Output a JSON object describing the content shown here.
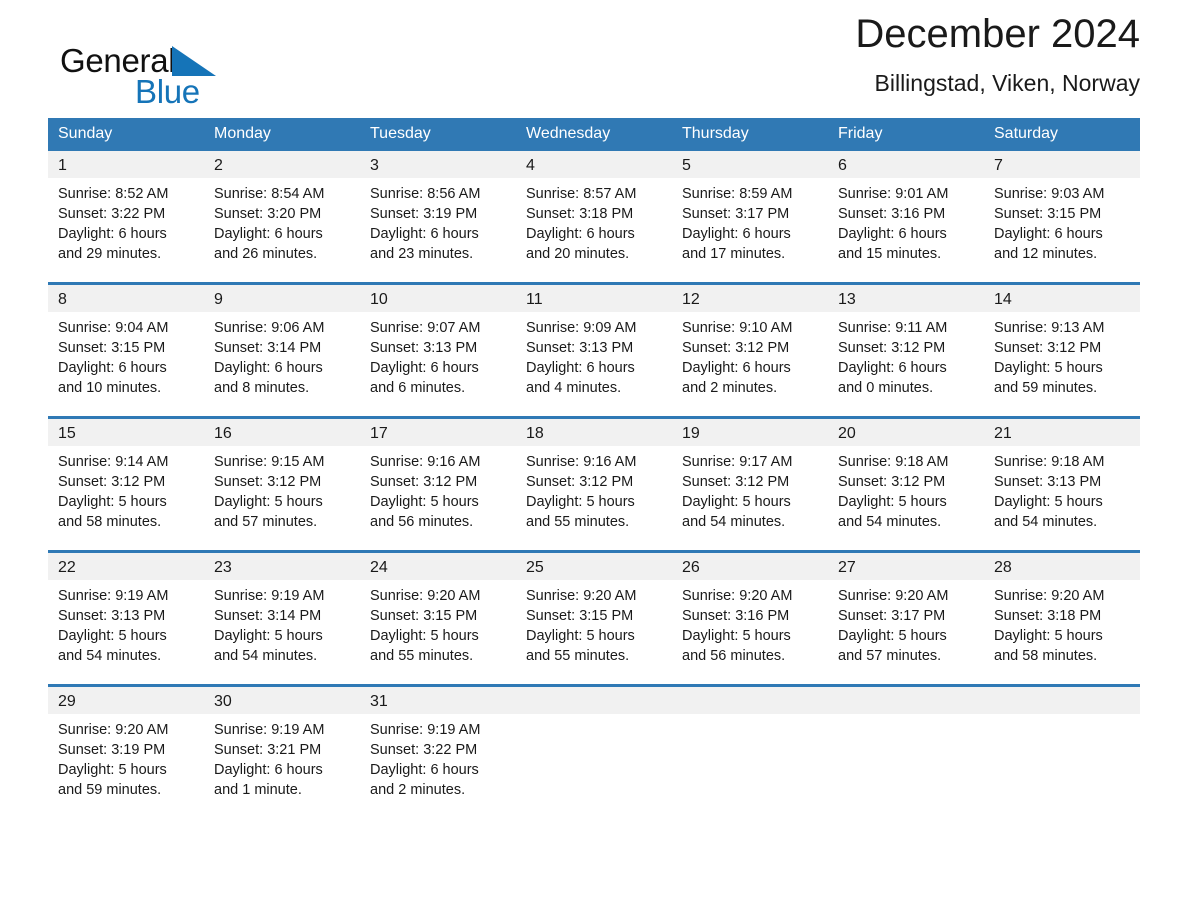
{
  "brand": {
    "name_part1": "General",
    "name_part2": "Blue",
    "triangle_icon": "blue-triangle-logo-mark",
    "accent_color": "#1574b8"
  },
  "header": {
    "title": "December 2024",
    "subtitle": "Billingstad, Viken, Norway"
  },
  "theme": {
    "header_row_bg": "#3079b4",
    "row_divider": "#2f79b5",
    "daynum_bg": "#f1f1f1",
    "page_bg": "#ffffff",
    "text": "#1a1a1a"
  },
  "weekday_headers": [
    "Sunday",
    "Monday",
    "Tuesday",
    "Wednesday",
    "Thursday",
    "Friday",
    "Saturday"
  ],
  "labels": {
    "sunrise_prefix": "Sunrise:",
    "sunset_prefix": "Sunset:",
    "daylight_prefix": "Daylight:"
  },
  "weeks": [
    [
      {
        "day": "1",
        "sunrise": "Sunrise: 8:52 AM",
        "sunset": "Sunset: 3:22 PM",
        "daylight_line1": "Daylight: 6 hours",
        "daylight_line2": "and 29 minutes."
      },
      {
        "day": "2",
        "sunrise": "Sunrise: 8:54 AM",
        "sunset": "Sunset: 3:20 PM",
        "daylight_line1": "Daylight: 6 hours",
        "daylight_line2": "and 26 minutes."
      },
      {
        "day": "3",
        "sunrise": "Sunrise: 8:56 AM",
        "sunset": "Sunset: 3:19 PM",
        "daylight_line1": "Daylight: 6 hours",
        "daylight_line2": "and 23 minutes."
      },
      {
        "day": "4",
        "sunrise": "Sunrise: 8:57 AM",
        "sunset": "Sunset: 3:18 PM",
        "daylight_line1": "Daylight: 6 hours",
        "daylight_line2": "and 20 minutes."
      },
      {
        "day": "5",
        "sunrise": "Sunrise: 8:59 AM",
        "sunset": "Sunset: 3:17 PM",
        "daylight_line1": "Daylight: 6 hours",
        "daylight_line2": "and 17 minutes."
      },
      {
        "day": "6",
        "sunrise": "Sunrise: 9:01 AM",
        "sunset": "Sunset: 3:16 PM",
        "daylight_line1": "Daylight: 6 hours",
        "daylight_line2": "and 15 minutes."
      },
      {
        "day": "7",
        "sunrise": "Sunrise: 9:03 AM",
        "sunset": "Sunset: 3:15 PM",
        "daylight_line1": "Daylight: 6 hours",
        "daylight_line2": "and 12 minutes."
      }
    ],
    [
      {
        "day": "8",
        "sunrise": "Sunrise: 9:04 AM",
        "sunset": "Sunset: 3:15 PM",
        "daylight_line1": "Daylight: 6 hours",
        "daylight_line2": "and 10 minutes."
      },
      {
        "day": "9",
        "sunrise": "Sunrise: 9:06 AM",
        "sunset": "Sunset: 3:14 PM",
        "daylight_line1": "Daylight: 6 hours",
        "daylight_line2": "and 8 minutes."
      },
      {
        "day": "10",
        "sunrise": "Sunrise: 9:07 AM",
        "sunset": "Sunset: 3:13 PM",
        "daylight_line1": "Daylight: 6 hours",
        "daylight_line2": "and 6 minutes."
      },
      {
        "day": "11",
        "sunrise": "Sunrise: 9:09 AM",
        "sunset": "Sunset: 3:13 PM",
        "daylight_line1": "Daylight: 6 hours",
        "daylight_line2": "and 4 minutes."
      },
      {
        "day": "12",
        "sunrise": "Sunrise: 9:10 AM",
        "sunset": "Sunset: 3:12 PM",
        "daylight_line1": "Daylight: 6 hours",
        "daylight_line2": "and 2 minutes."
      },
      {
        "day": "13",
        "sunrise": "Sunrise: 9:11 AM",
        "sunset": "Sunset: 3:12 PM",
        "daylight_line1": "Daylight: 6 hours",
        "daylight_line2": "and 0 minutes."
      },
      {
        "day": "14",
        "sunrise": "Sunrise: 9:13 AM",
        "sunset": "Sunset: 3:12 PM",
        "daylight_line1": "Daylight: 5 hours",
        "daylight_line2": "and 59 minutes."
      }
    ],
    [
      {
        "day": "15",
        "sunrise": "Sunrise: 9:14 AM",
        "sunset": "Sunset: 3:12 PM",
        "daylight_line1": "Daylight: 5 hours",
        "daylight_line2": "and 58 minutes."
      },
      {
        "day": "16",
        "sunrise": "Sunrise: 9:15 AM",
        "sunset": "Sunset: 3:12 PM",
        "daylight_line1": "Daylight: 5 hours",
        "daylight_line2": "and 57 minutes."
      },
      {
        "day": "17",
        "sunrise": "Sunrise: 9:16 AM",
        "sunset": "Sunset: 3:12 PM",
        "daylight_line1": "Daylight: 5 hours",
        "daylight_line2": "and 56 minutes."
      },
      {
        "day": "18",
        "sunrise": "Sunrise: 9:16 AM",
        "sunset": "Sunset: 3:12 PM",
        "daylight_line1": "Daylight: 5 hours",
        "daylight_line2": "and 55 minutes."
      },
      {
        "day": "19",
        "sunrise": "Sunrise: 9:17 AM",
        "sunset": "Sunset: 3:12 PM",
        "daylight_line1": "Daylight: 5 hours",
        "daylight_line2": "and 54 minutes."
      },
      {
        "day": "20",
        "sunrise": "Sunrise: 9:18 AM",
        "sunset": "Sunset: 3:12 PM",
        "daylight_line1": "Daylight: 5 hours",
        "daylight_line2": "and 54 minutes."
      },
      {
        "day": "21",
        "sunrise": "Sunrise: 9:18 AM",
        "sunset": "Sunset: 3:13 PM",
        "daylight_line1": "Daylight: 5 hours",
        "daylight_line2": "and 54 minutes."
      }
    ],
    [
      {
        "day": "22",
        "sunrise": "Sunrise: 9:19 AM",
        "sunset": "Sunset: 3:13 PM",
        "daylight_line1": "Daylight: 5 hours",
        "daylight_line2": "and 54 minutes."
      },
      {
        "day": "23",
        "sunrise": "Sunrise: 9:19 AM",
        "sunset": "Sunset: 3:14 PM",
        "daylight_line1": "Daylight: 5 hours",
        "daylight_line2": "and 54 minutes."
      },
      {
        "day": "24",
        "sunrise": "Sunrise: 9:20 AM",
        "sunset": "Sunset: 3:15 PM",
        "daylight_line1": "Daylight: 5 hours",
        "daylight_line2": "and 55 minutes."
      },
      {
        "day": "25",
        "sunrise": "Sunrise: 9:20 AM",
        "sunset": "Sunset: 3:15 PM",
        "daylight_line1": "Daylight: 5 hours",
        "daylight_line2": "and 55 minutes."
      },
      {
        "day": "26",
        "sunrise": "Sunrise: 9:20 AM",
        "sunset": "Sunset: 3:16 PM",
        "daylight_line1": "Daylight: 5 hours",
        "daylight_line2": "and 56 minutes."
      },
      {
        "day": "27",
        "sunrise": "Sunrise: 9:20 AM",
        "sunset": "Sunset: 3:17 PM",
        "daylight_line1": "Daylight: 5 hours",
        "daylight_line2": "and 57 minutes."
      },
      {
        "day": "28",
        "sunrise": "Sunrise: 9:20 AM",
        "sunset": "Sunset: 3:18 PM",
        "daylight_line1": "Daylight: 5 hours",
        "daylight_line2": "and 58 minutes."
      }
    ],
    [
      {
        "day": "29",
        "sunrise": "Sunrise: 9:20 AM",
        "sunset": "Sunset: 3:19 PM",
        "daylight_line1": "Daylight: 5 hours",
        "daylight_line2": "and 59 minutes."
      },
      {
        "day": "30",
        "sunrise": "Sunrise: 9:19 AM",
        "sunset": "Sunset: 3:21 PM",
        "daylight_line1": "Daylight: 6 hours",
        "daylight_line2": "and 1 minute."
      },
      {
        "day": "31",
        "sunrise": "Sunrise: 9:19 AM",
        "sunset": "Sunset: 3:22 PM",
        "daylight_line1": "Daylight: 6 hours",
        "daylight_line2": "and 2 minutes."
      },
      null,
      null,
      null,
      null
    ]
  ]
}
